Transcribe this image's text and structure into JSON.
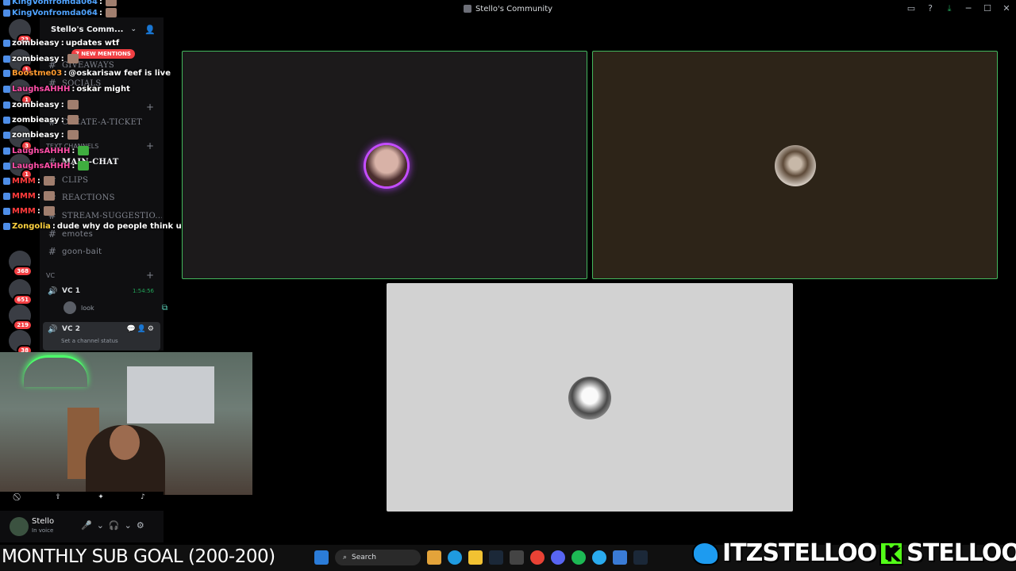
{
  "window": {
    "title": "Stello's Community"
  },
  "server": {
    "name": "Stello's Comm...",
    "mentions_badge": "7 NEW MENTIONS"
  },
  "rail_badges": [
    "23",
    "1",
    "1",
    "3",
    "1",
    "368",
    "651",
    "219",
    "38"
  ],
  "channels": [
    {
      "name": "GIVEAWAYS",
      "active": false
    },
    {
      "name": "SOCIALS",
      "active": false
    },
    {
      "name": "CREATE-A-TICKET",
      "active": false
    },
    {
      "name": "MAIN-CHAT",
      "active": true
    },
    {
      "name": "CLIPS",
      "active": false
    },
    {
      "name": "REACTIONS",
      "active": false
    },
    {
      "name": "STREAM-SUGGESTIO...",
      "active": false
    },
    {
      "name": "emotes",
      "active": false
    },
    {
      "name": "goon-bait",
      "active": false
    }
  ],
  "categories": {
    "text": "Text channels",
    "voice": "VC"
  },
  "voice_channels": [
    {
      "name": "VC 1",
      "timer": "1:54:56",
      "member": "look"
    },
    {
      "name": "VC 2",
      "status_placeholder": "Set a channel status"
    }
  ],
  "chat": [
    {
      "user": "KingVonfromda064",
      "text": "",
      "color": "#4fa3ff"
    },
    {
      "user": "KingVonfromda064",
      "text": "",
      "color": "#4fa3ff"
    },
    {
      "user": "zombieasy",
      "text": "updates wtf",
      "color": "#ffffff"
    },
    {
      "user": "zombieasy",
      "text": "",
      "color": "#ffffff"
    },
    {
      "user": "Boostme03",
      "text": "@oskarisaw feef is live",
      "color": "#ff9b2f"
    },
    {
      "user": "LaughsAHHH",
      "text": "oskar might",
      "color": "#ff4fa8"
    },
    {
      "user": "zombieasy",
      "text": "",
      "color": "#ffffff"
    },
    {
      "user": "zombieasy",
      "text": "",
      "color": "#ffffff"
    },
    {
      "user": "zombieasy",
      "text": "",
      "color": "#ffffff"
    },
    {
      "user": "LaughsAHHH",
      "text": "",
      "color": "#ff4fa8"
    },
    {
      "user": "LaughsAHHH",
      "text": "",
      "color": "#ff4fa8"
    },
    {
      "user": "MMM",
      "text": "",
      "color": "#ff3b3b"
    },
    {
      "user": "MMM",
      "text": "",
      "color": "#ff3b3b"
    },
    {
      "user": "MMM",
      "text": "",
      "color": "#ff3b3b"
    },
    {
      "user": "Zongolia",
      "text": "dude why do people think ur creep",
      "color": "#ffd23f"
    }
  ],
  "user_panel": {
    "name": "Stello",
    "status": "In voice"
  },
  "taskbar": {
    "subgoal": "MONTHLY SUB GOAL (200-200)",
    "search": "Search"
  },
  "socials": {
    "twitter": "ITZSTELLOO",
    "kick": "STELLOOO"
  },
  "colors": {
    "speaking_ring": "#43b75d",
    "accent_red": "#f23f43",
    "voice_green": "#23a55a"
  }
}
